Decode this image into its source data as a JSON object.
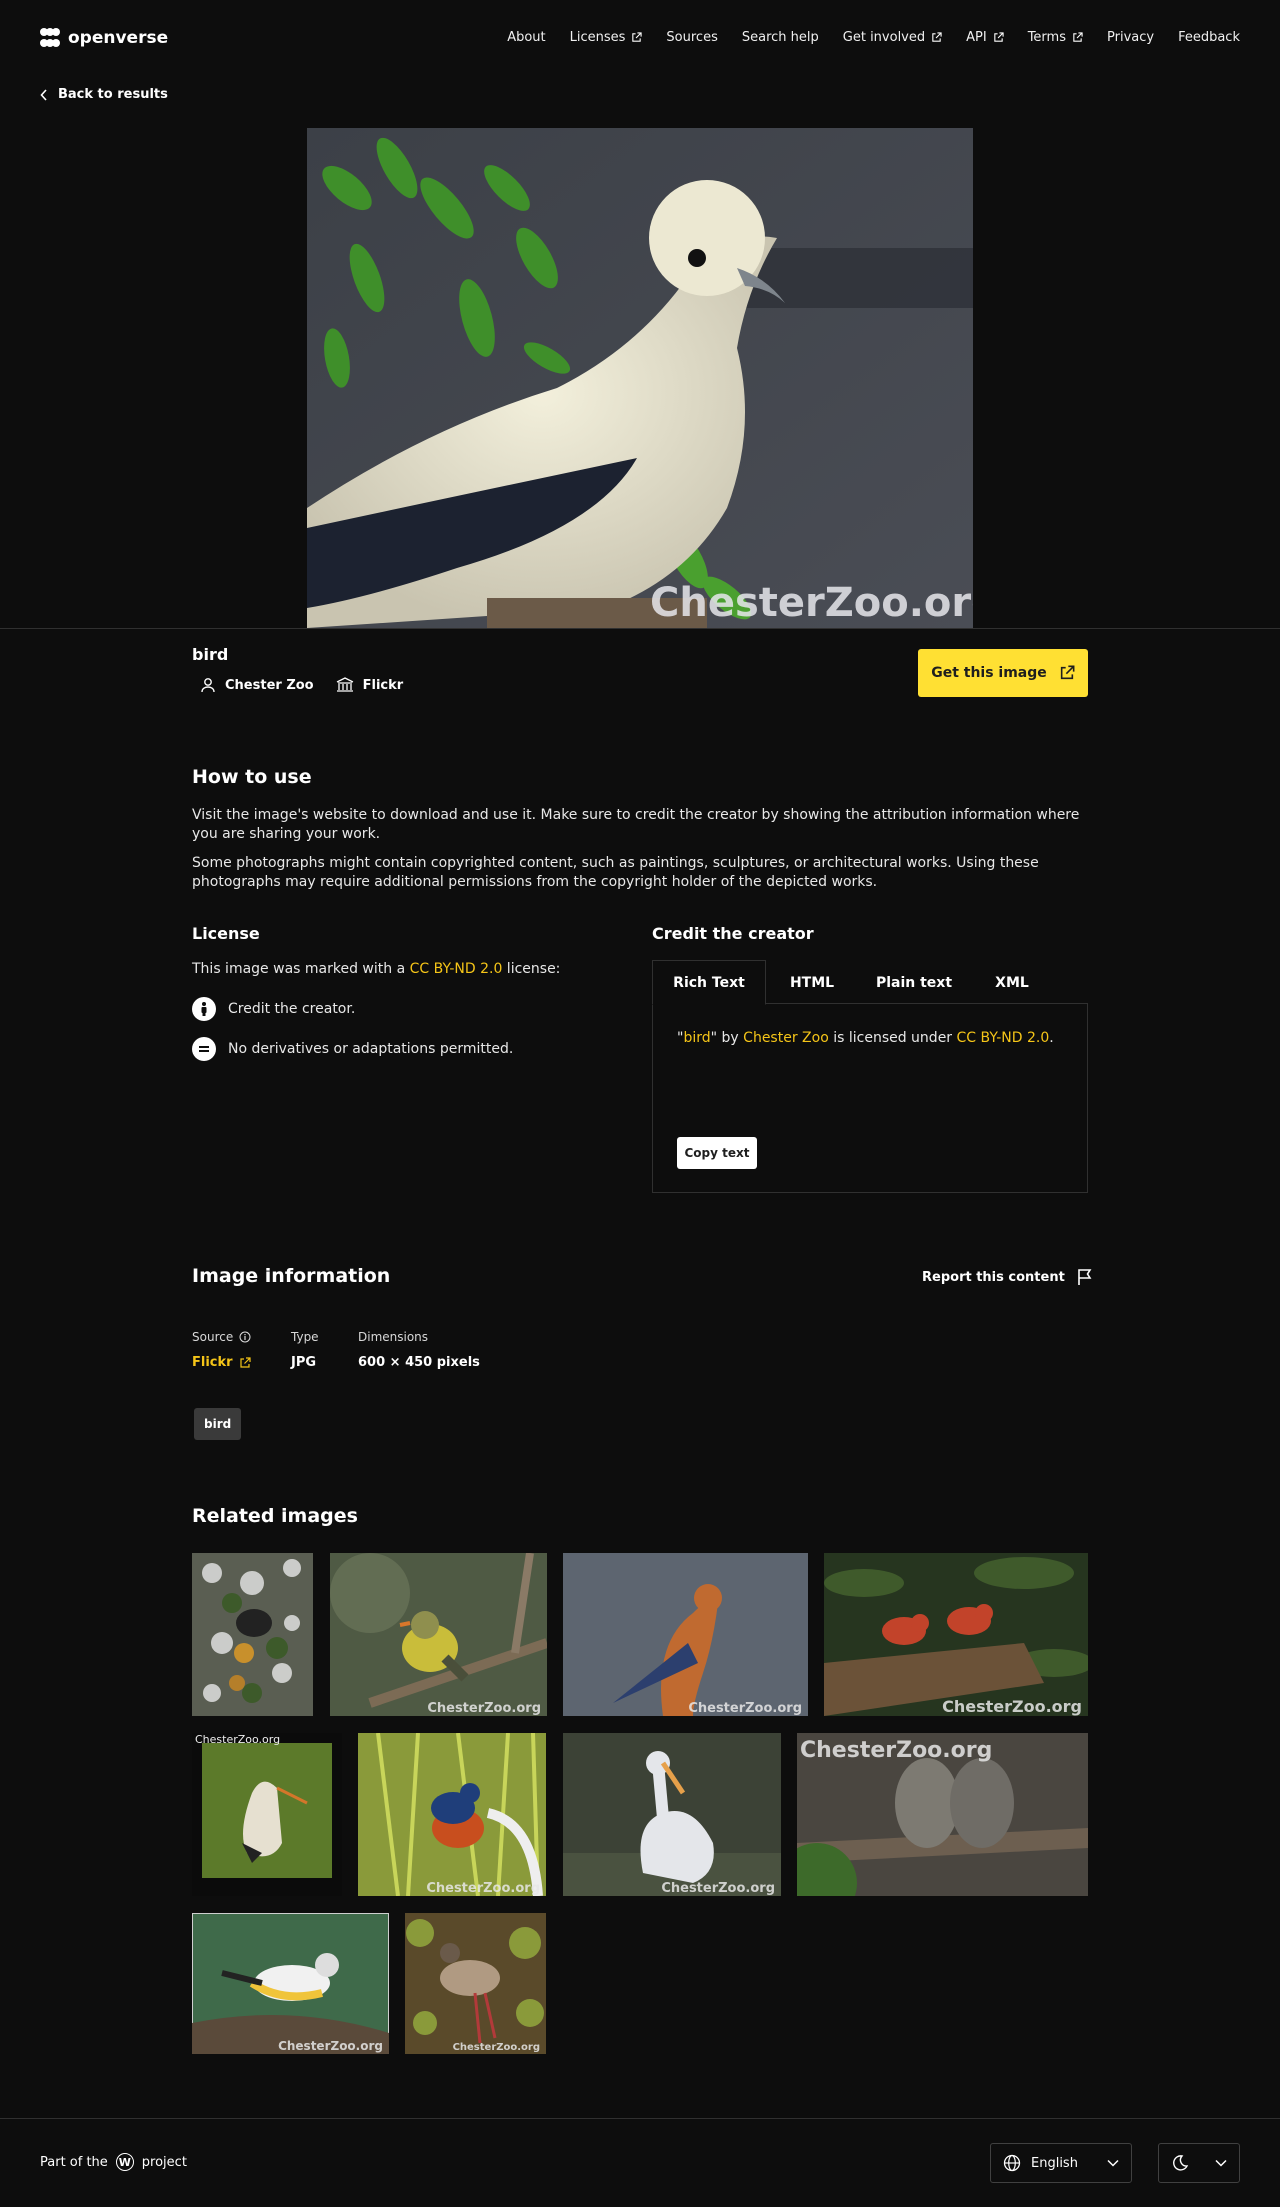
{
  "header": {
    "logo": "openverse",
    "nav": [
      {
        "label": "About",
        "external": false
      },
      {
        "label": "Licenses",
        "external": true
      },
      {
        "label": "Sources",
        "external": false
      },
      {
        "label": "Search help",
        "external": false
      },
      {
        "label": "Get involved",
        "external": true
      },
      {
        "label": "API",
        "external": true
      },
      {
        "label": "Terms",
        "external": true
      },
      {
        "label": "Privacy",
        "external": false
      },
      {
        "label": "Feedback",
        "external": false
      }
    ]
  },
  "back_link": "Back to results",
  "hero": {
    "watermark": "ChesterZoo.org"
  },
  "image": {
    "title": "bird",
    "creator": "Chester Zoo",
    "source": "Flickr",
    "get_button": "Get this image"
  },
  "how_to_use": {
    "heading": "How to use",
    "p1": "Visit the image's website to download and use it. Make sure to credit the creator by showing the attribution information where you are sharing your work.",
    "p2": "Some photographs might contain copyrighted content, such as paintings, sculptures, or architectural works. Using these photographs may require additional permissions from the copyright holder of the depicted works."
  },
  "license": {
    "heading": "License",
    "intro_pre": "This image was marked with a ",
    "license_name": "CC BY-ND 2.0",
    "intro_post": " license:",
    "items": [
      "Credit the creator.",
      "No derivatives or adaptations permitted."
    ]
  },
  "credit": {
    "heading": "Credit the creator",
    "tabs": [
      "Rich Text",
      "HTML",
      "Plain text",
      "XML"
    ],
    "active_tab": "Rich Text",
    "q_open": "\"",
    "title": "bird",
    "q_close": "\"",
    "by": " by ",
    "creator": "Chester Zoo",
    "licensed": " is licensed under ",
    "license": "CC BY-ND 2.0",
    "end": ".",
    "copy_button": "Copy text"
  },
  "info": {
    "heading": "Image information",
    "report": "Report this content",
    "source_label": "Source",
    "source_value": "Flickr",
    "type_label": "Type",
    "type_value": "JPG",
    "dims_label": "Dimensions",
    "dims_value": "600 × 450 pixels",
    "tags": [
      "bird"
    ]
  },
  "related": {
    "heading": "Related images",
    "watermarks": [
      "ChesterZoo.org",
      "ChesterZoo.org",
      "ChesterZoo.org",
      "ChesterZoo.org",
      "ChesterZoo.org",
      "ChesterZoo.org",
      "ChesterZoo.org",
      "ChesterZoo.org",
      "ChesterZoo.org"
    ]
  },
  "footer": {
    "part_pre": "Part of the",
    "part_post": "project",
    "language": "English"
  },
  "colors": {
    "accent": "#ffe033",
    "link": "#f5c518",
    "background": "#0d0d0d"
  }
}
